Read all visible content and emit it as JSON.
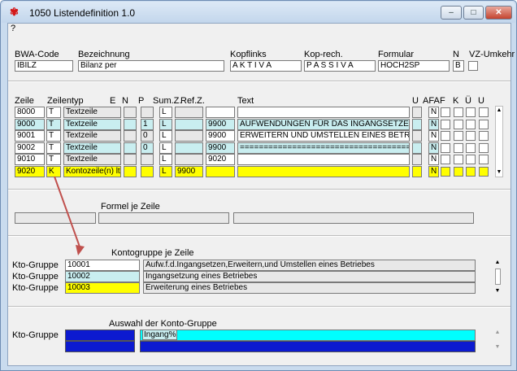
{
  "window": {
    "title": "1050 Listendefinition 1.0",
    "minimize": "–",
    "maximize": "□",
    "close": "✕"
  },
  "menu": {
    "help": "?"
  },
  "header": {
    "bwa_code_label": "BWA-Code",
    "bwa_code_value": "IBILZ",
    "bezeichnung_label": "Bezeichnung",
    "bezeichnung_value": "Bilanz per",
    "kopf_links_label": "Kopflinks",
    "kopf_links_value": "A K T I V A",
    "kopf_rech_label": "Kop-rech.",
    "kopf_rech_value": "P A S S I V A",
    "formular_label": "Formular",
    "formular_value": "HOCH2SP",
    "n_label": "N",
    "n_value": "B",
    "vz_label": "VZ-Umkehr"
  },
  "grid": {
    "columns": [
      "Zeile",
      "Zeilentyp",
      "E",
      "N",
      "P",
      "Sum.Z.",
      "Ref.Z.",
      "Text",
      "U",
      "AFA",
      "F",
      "K",
      "Ü",
      "U"
    ],
    "rows": [
      {
        "zeile": "8000",
        "typ": "T",
        "typtext": "Textzeile",
        "e": "",
        "n": "",
        "p": "L",
        "sumz": "",
        "refz": "",
        "text": "",
        "afa": "N"
      },
      {
        "zeile": "9000",
        "typ": "T",
        "typtext": "Textzeile",
        "e": "",
        "n": "1",
        "p": "L",
        "sumz": "",
        "refz": "9900",
        "text": "AUFWENDUNGEN FÜR DAS INGANGSETZEN",
        "afa": "N"
      },
      {
        "zeile": "9001",
        "typ": "T",
        "typtext": "Textzeile",
        "e": "",
        "n": "0",
        "p": "L",
        "sumz": "",
        "refz": "9900",
        "text": "ERWEITERN UND UMSTELLEN EINES BETRIE",
        "afa": "N"
      },
      {
        "zeile": "9002",
        "typ": "T",
        "typtext": "Textzeile",
        "e": "",
        "n": "0",
        "p": "L",
        "sumz": "",
        "refz": "9900",
        "text": "=====================================",
        "afa": "N"
      },
      {
        "zeile": "9010",
        "typ": "T",
        "typtext": "Textzeile",
        "e": "",
        "n": "",
        "p": "L",
        "sumz": "",
        "refz": "9020",
        "text": "",
        "afa": "N"
      },
      {
        "zeile": "9020",
        "typ": "K",
        "typtext": "Kontozeile(n) lt.",
        "e": "",
        "n": "",
        "p": "L",
        "sumz": "9900",
        "refz": "",
        "text": "",
        "afa": "N"
      }
    ]
  },
  "formel": {
    "title": "Formel je Zeile"
  },
  "kontogruppe": {
    "title": "Kontogruppe je Zeile",
    "rows": [
      {
        "label": "Kto-Gruppe",
        "code": "10001",
        "text": "Aufw.f.d.Ingangsetzen,Erweitern,und Umstellen eines Betriebes"
      },
      {
        "label": "Kto-Gruppe",
        "code": "10002",
        "text": "Ingangsetzung eines Betriebes"
      },
      {
        "label": "Kto-Gruppe",
        "code": "10003",
        "text": "Erweiterung eines Betriebes"
      }
    ]
  },
  "auswahl": {
    "title": "Auswahl der Konto-Gruppe",
    "label": "Kto-Gruppe",
    "search_value": "Ingang%"
  },
  "colors": {
    "annotation_arrow": "#c0504d",
    "selection_blue": "#0c1ad0",
    "highlight_yellow": "#ffff00",
    "cyan": "#00ffff"
  }
}
